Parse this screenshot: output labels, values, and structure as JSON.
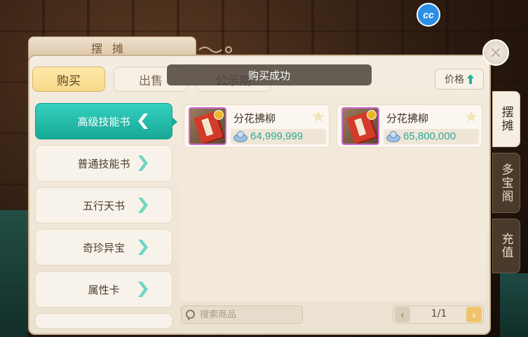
{
  "badge": {
    "cc_label": "cc"
  },
  "window": {
    "title": "摆摊",
    "close_label": "×"
  },
  "tabs": [
    {
      "label": "购买"
    },
    {
      "label": "出售"
    },
    {
      "label": "公示期"
    }
  ],
  "toast": {
    "text": "购买成功"
  },
  "sort": {
    "label": "价格"
  },
  "categories": [
    {
      "label": "高级技能书"
    },
    {
      "label": "普通技能书"
    },
    {
      "label": "五行天书"
    },
    {
      "label": "奇珍异宝"
    },
    {
      "label": "属性卡"
    }
  ],
  "items": [
    {
      "name": "分花拂柳",
      "price": "64,999,999"
    },
    {
      "name": "分花拂柳",
      "price": "65,800,000"
    }
  ],
  "search": {
    "placeholder": "搜索商品"
  },
  "pager": {
    "text": "1/1",
    "prev": "‹",
    "next": "›"
  },
  "side_tabs": [
    {
      "label": "摆摊"
    },
    {
      "label": "多宝阁"
    },
    {
      "label": "充值"
    }
  ],
  "colors": {
    "accent": "#1fb59a",
    "buy_tab": "#f6d98a",
    "panel": "#f4ece0"
  }
}
